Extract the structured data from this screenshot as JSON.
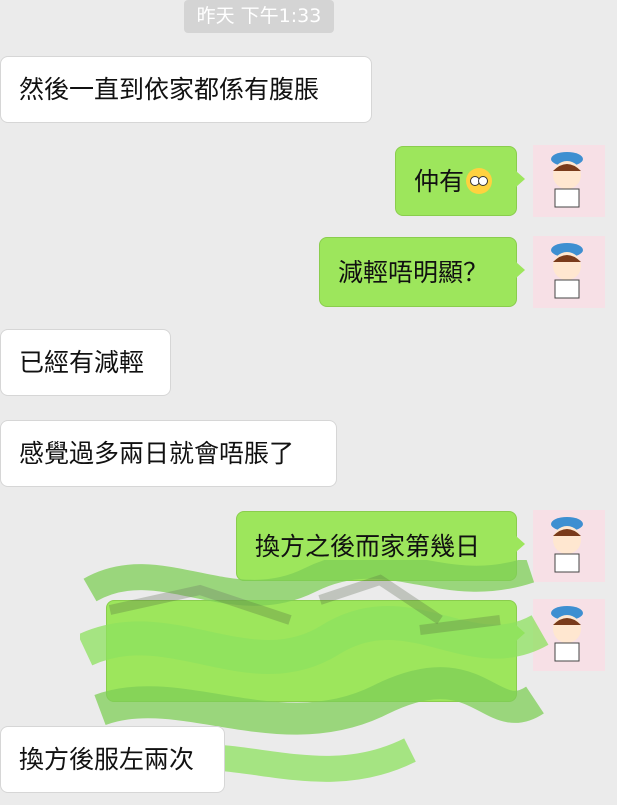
{
  "timestamp": "昨天 下午1:33",
  "messages": [
    {
      "side": "left",
      "text": "然後一直到依家都係有腹脹"
    },
    {
      "side": "right",
      "text": "仲有",
      "emoji": "astonished-face-icon"
    },
    {
      "side": "right",
      "text": "減輕唔明顯？"
    },
    {
      "side": "left",
      "text": "已經有減輕"
    },
    {
      "side": "left",
      "text": "感覺過多兩日就會唔脹了"
    },
    {
      "side": "right",
      "text": "換方之後而家第幾日"
    },
    {
      "side": "right",
      "text": "",
      "redacted": true
    },
    {
      "side": "left",
      "text": "換方後服左兩次"
    }
  ],
  "colors": {
    "background": "#ebebeb",
    "sent_bubble": "#9de65c",
    "received_bubble": "#ffffff"
  }
}
